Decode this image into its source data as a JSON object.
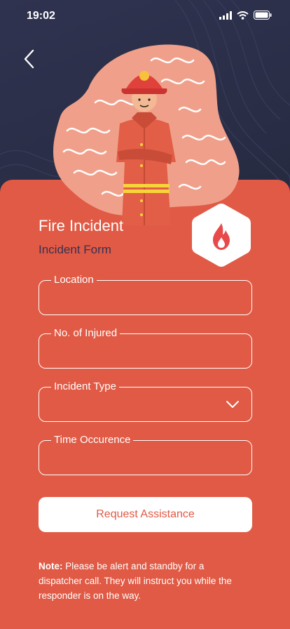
{
  "status_bar": {
    "time": "19:02",
    "icons": [
      "signal-icon",
      "wifi-icon",
      "battery-icon"
    ]
  },
  "nav": {
    "back_icon": "chevron-left-icon"
  },
  "illustration": {
    "subject": "firefighter"
  },
  "badge": {
    "icon": "flame-icon"
  },
  "header": {
    "title": "Fire Incident",
    "subtitle": "Incident Form"
  },
  "form": {
    "fields": [
      {
        "label": "Location",
        "value": ""
      },
      {
        "label": "No. of Injured",
        "value": ""
      },
      {
        "label": "Incident Type",
        "value": "",
        "icon": "chevron-down-icon"
      },
      {
        "label": "Time Occurence",
        "value": ""
      }
    ],
    "submit_label": "Request Assistance"
  },
  "note": {
    "prefix": "Note:",
    "text": " Please be alert and standby for a dispatcher call. They will instruct you while the responder is on the way."
  },
  "colors": {
    "card": "#e05a45",
    "background": "#2a2e45",
    "accent_text": "#3a3150",
    "white": "#ffffff"
  }
}
